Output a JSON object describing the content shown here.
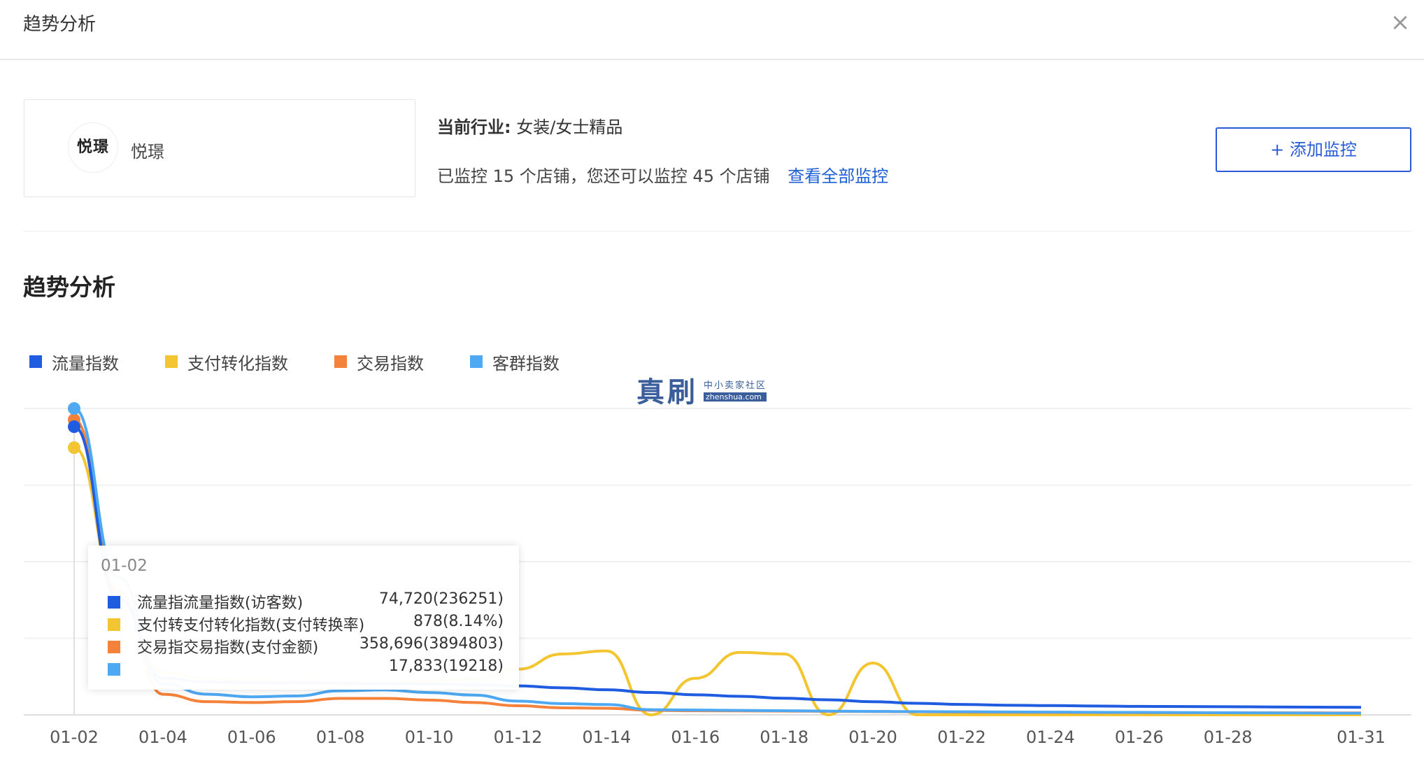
{
  "modal": {
    "title": "趋势分析"
  },
  "shop": {
    "logo_text": "悦璟",
    "name": "悦璟"
  },
  "industry": {
    "label": "当前行业:",
    "value": "女装/女士精品"
  },
  "monitor": {
    "text": "已监控 15 个店铺，您还可以监控 45 个店铺",
    "link_label": "查看全部监控"
  },
  "add_button": {
    "label": "+ 添加监控"
  },
  "section": {
    "title": "趋势分析"
  },
  "watermark": {
    "main": "真刷",
    "cn": "中小卖家社区",
    "en": "zhenshua.com"
  },
  "colors": {
    "traffic": "#1f5ce0",
    "conversion": "#f2c531",
    "trade": "#f5823a",
    "customer": "#4ea9f2",
    "link": "#1e5fd6",
    "grid": "#eeeeee"
  },
  "legend": [
    {
      "label": "流量指数",
      "color": "#1f5ce0"
    },
    {
      "label": "支付转化指数",
      "color": "#f2c531"
    },
    {
      "label": "交易指数",
      "color": "#f5823a"
    },
    {
      "label": "客群指数",
      "color": "#4ea9f2"
    }
  ],
  "tooltip": {
    "date": "01-02",
    "rows": [
      {
        "label": "流量指流量指数(访客数)",
        "value": "74,720(236251)",
        "color": "#1f5ce0"
      },
      {
        "label": "支付转支付转化指数(支付转换率)",
        "value": "878(8.14%)",
        "color": "#f2c531"
      },
      {
        "label": "交易指交易指数(支付金额)",
        "value": "358,696(3894803)",
        "color": "#f5823a"
      },
      {
        "label": "",
        "value": "17,833(19218)",
        "color": "#4ea9f2"
      }
    ]
  },
  "chart_data": {
    "type": "line",
    "x": [
      "01-02",
      "01-03",
      "01-04",
      "01-05",
      "01-06",
      "01-07",
      "01-08",
      "01-09",
      "01-10",
      "01-11",
      "01-12",
      "01-13",
      "01-14",
      "01-15",
      "01-16",
      "01-17",
      "01-18",
      "01-19",
      "01-20",
      "01-21",
      "01-22",
      "01-23",
      "01-24",
      "01-25",
      "01-26",
      "01-27",
      "01-28",
      "01-29",
      "01-30",
      "01-31"
    ],
    "xticks": [
      "01-02",
      "01-04",
      "01-06",
      "01-08",
      "01-10",
      "01-12",
      "01-14",
      "01-16",
      "01-18",
      "01-20",
      "01-22",
      "01-24",
      "01-26",
      "01-28",
      "01-31"
    ],
    "grid": true,
    "series": [
      {
        "name": "流量指数",
        "color": "#1f5ce0",
        "values": [
          74720,
          30000,
          9500,
          8500,
          8400,
          8300,
          8200,
          8100,
          8000,
          7800,
          7500,
          7000,
          6500,
          5800,
          5200,
          4800,
          4300,
          3900,
          3400,
          3000,
          2700,
          2500,
          2400,
          2300,
          2200,
          2150,
          2100,
          2050,
          2000,
          1950
        ]
      },
      {
        "name": "支付转化指数",
        "color": "#f2c531",
        "values": [
          878,
          400,
          140,
          120,
          110,
          105,
          100,
          105,
          110,
          118,
          150,
          200,
          210,
          0,
          120,
          205,
          200,
          0,
          170,
          0,
          0,
          0,
          0,
          0,
          0,
          0,
          0,
          0,
          0,
          0
        ]
      },
      {
        "name": "交易指数",
        "color": "#f5823a",
        "values": [
          358696,
          150000,
          25000,
          16000,
          15000,
          16000,
          20000,
          20000,
          18000,
          15000,
          11000,
          8500,
          8000,
          5500,
          5000,
          4800,
          4600,
          4300,
          4000,
          3700,
          3300,
          3100,
          2900,
          2800,
          2700,
          2600,
          2500,
          2450,
          2400,
          2350
        ]
      },
      {
        "name": "客群指数",
        "color": "#4ea9f2",
        "values": [
          17833,
          8000,
          1800,
          1200,
          1050,
          1100,
          1400,
          1450,
          1300,
          1150,
          800,
          650,
          600,
          300,
          280,
          260,
          240,
          220,
          200,
          190,
          180,
          170,
          160,
          150,
          140,
          130,
          120,
          110,
          100,
          95
        ]
      }
    ]
  }
}
